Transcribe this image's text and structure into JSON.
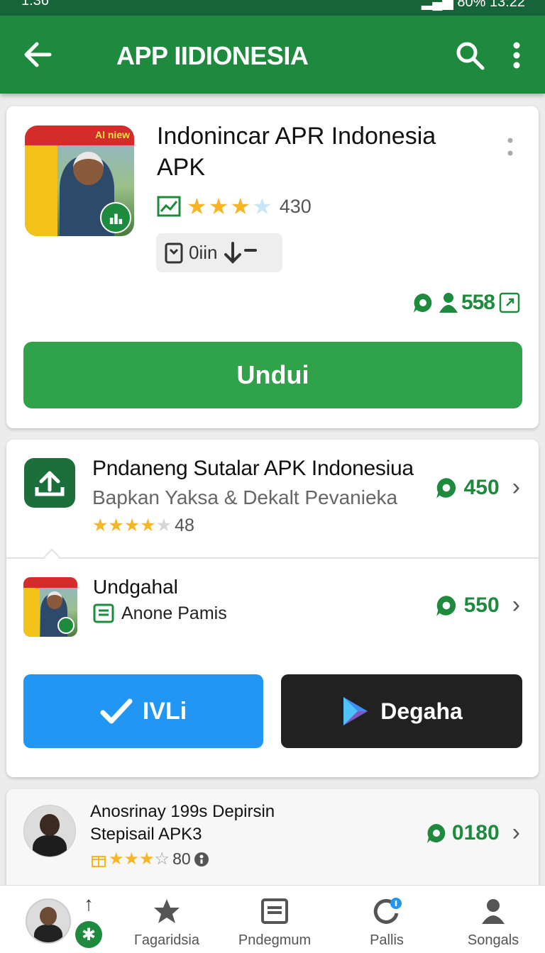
{
  "status_bar": {
    "time": "1:36",
    "battery": "80%",
    "clock": "13:22"
  },
  "header": {
    "title": "APP IIDIONESIA"
  },
  "featured": {
    "app_name": "Indonincar APR Indonesia APK",
    "icon_banner": "Al niew",
    "rating_stars": 3.5,
    "rating_count": "430",
    "chip_label": "0iin",
    "downloads": "558",
    "primary_button": "Undui"
  },
  "list": {
    "item1": {
      "title": "Pndaneng Sutalar APK Indonesiua",
      "subtitle": "Bapkan Yaksa & Dekalt Pevanieka",
      "rating_stars": 4,
      "rating_count": "48",
      "price": "450"
    },
    "item2": {
      "title": "Undgahal",
      "tag": "Anone Pamis",
      "price": "550"
    },
    "buttons": {
      "blue": "IVLi",
      "dark": "Degaha"
    }
  },
  "recommend": {
    "title_line1": "Anosrinay 199s Depirsin",
    "title_line2": "Stepisail APK3",
    "rating_stars": 3,
    "rating_count": "80",
    "price": "0180"
  },
  "nav": {
    "items": [
      {
        "label": "Гagaridsia",
        "icon": "star-icon"
      },
      {
        "label": "Pndegmum",
        "icon": "window-icon"
      },
      {
        "label": "Pallis",
        "icon": "refresh-icon"
      },
      {
        "label": "Songals",
        "icon": "person-icon"
      }
    ]
  },
  "colors": {
    "primary": "#1d8a3e",
    "button_green": "#2fa24a",
    "button_blue": "#2196f3",
    "button_dark": "#212121",
    "star": "#f5b524"
  }
}
